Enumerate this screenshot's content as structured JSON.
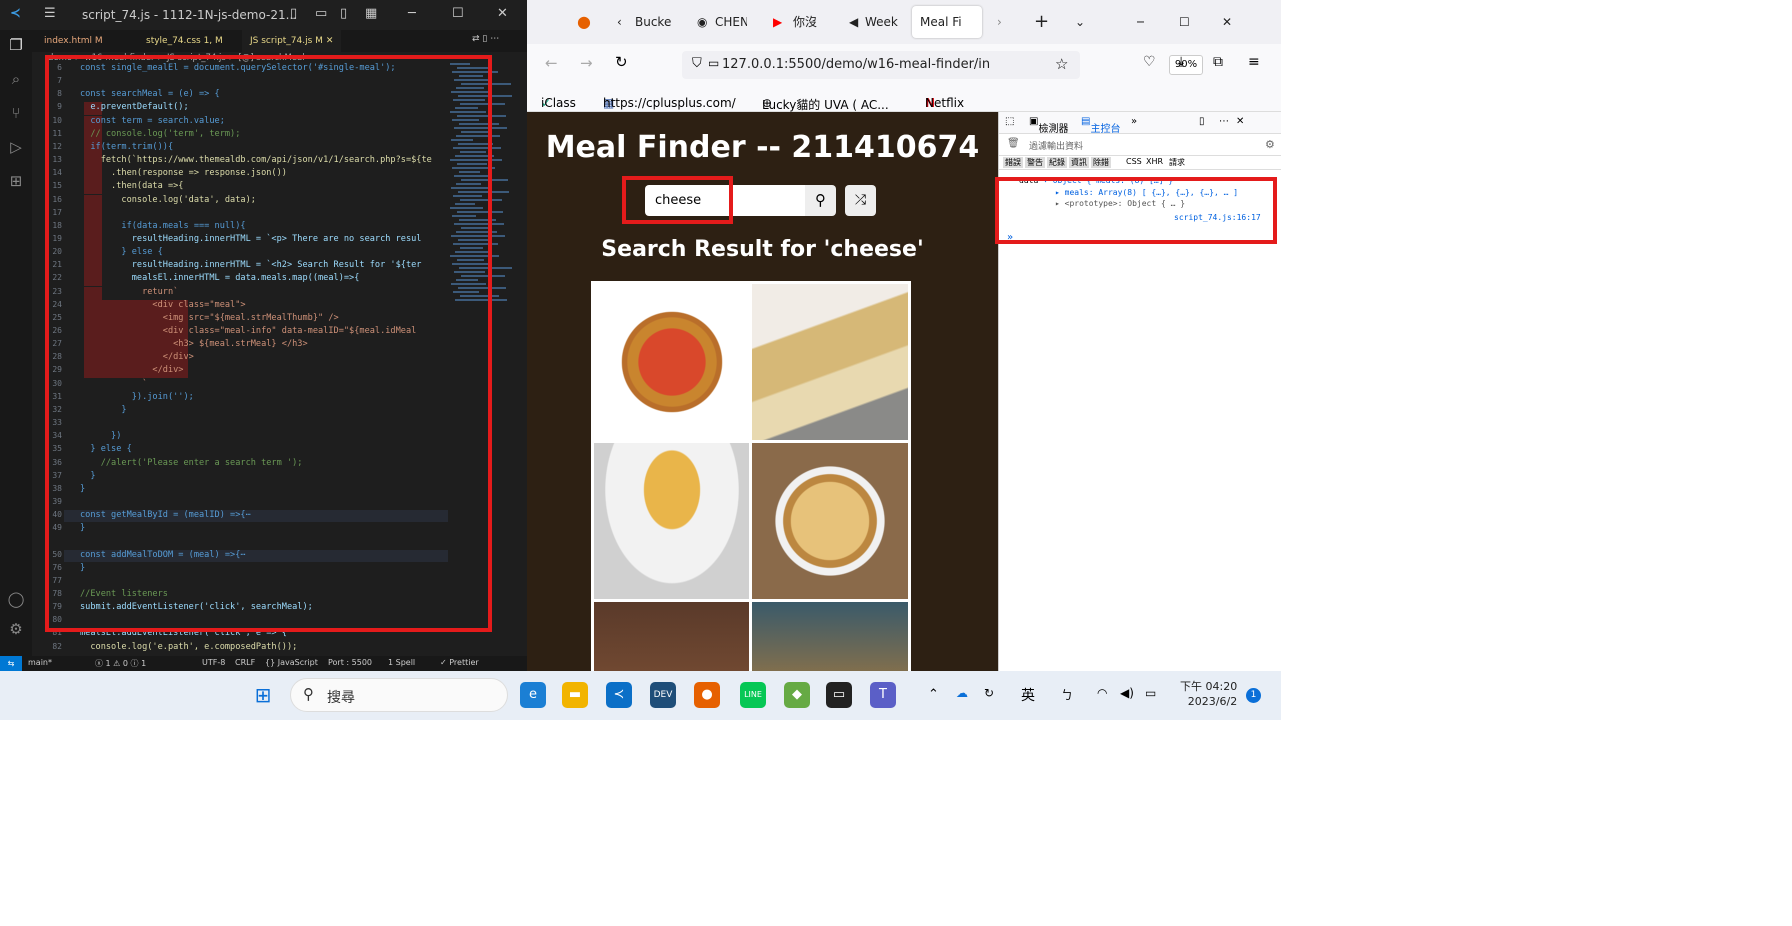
{
  "vscode": {
    "title": "script_74.js - 1112-1N-js-demo-21...",
    "tabs": [
      {
        "label": "index.html M",
        "active": false
      },
      {
        "label": "style_74.css 1, M",
        "active": false
      },
      {
        "label": "JS script_74.js M",
        "active": true
      }
    ],
    "breadcrumb": "demo > w16-meal-finder > JS script_74.js > [@] searchMeal",
    "code_lines": [
      {
        "n": "6",
        "t": "const single_mealEl = document.querySelector('#single-meal');"
      },
      {
        "n": "7",
        "t": ""
      },
      {
        "n": "8",
        "t": "const searchMeal = (e) => {"
      },
      {
        "n": "9",
        "t": "  e.preventDefault();"
      },
      {
        "n": "10",
        "t": "  const term = search.value;"
      },
      {
        "n": "11",
        "t": "  // console.log('term', term);"
      },
      {
        "n": "12",
        "t": "  if(term.trim()){"
      },
      {
        "n": "13",
        "t": "    fetch(`https://www.themealdb.com/api/json/v1/1/search.php?s=${te"
      },
      {
        "n": "14",
        "t": "      .then(response => response.json())"
      },
      {
        "n": "15",
        "t": "      .then(data =>{"
      },
      {
        "n": "16",
        "t": "        console.log('data', data);"
      },
      {
        "n": "17",
        "t": ""
      },
      {
        "n": "18",
        "t": "        if(data.meals === null){"
      },
      {
        "n": "19",
        "t": "          resultHeading.innerHTML = `<p> There are no search resul"
      },
      {
        "n": "20",
        "t": "        } else {"
      },
      {
        "n": "21",
        "t": "          resultHeading.innerHTML = `<h2> Search Result for '${ter"
      },
      {
        "n": "22",
        "t": "          mealsEl.innerHTML = data.meals.map((meal)=>{"
      },
      {
        "n": "23",
        "t": "            return`"
      },
      {
        "n": "24",
        "t": "              <div class=\"meal\">"
      },
      {
        "n": "25",
        "t": "                <img src=\"${meal.strMealThumb}\" />"
      },
      {
        "n": "26",
        "t": "                <div class=\"meal-info\" data-mealID=\"${meal.idMeal"
      },
      {
        "n": "27",
        "t": "                  <h3> ${meal.strMeal} </h3>"
      },
      {
        "n": "28",
        "t": "                </div>"
      },
      {
        "n": "29",
        "t": "              </div>"
      },
      {
        "n": "30",
        "t": "            `"
      },
      {
        "n": "31",
        "t": "          }).join('');"
      },
      {
        "n": "32",
        "t": "        }"
      },
      {
        "n": "33",
        "t": ""
      },
      {
        "n": "34",
        "t": "      })"
      },
      {
        "n": "35",
        "t": "  } else {"
      },
      {
        "n": "36",
        "t": "    //alert('Please enter a search term ');"
      },
      {
        "n": "37",
        "t": "  }"
      },
      {
        "n": "38",
        "t": "}"
      },
      {
        "n": "39",
        "t": ""
      },
      {
        "n": "40",
        "t": "const getMealById = (mealID) =>{⋯"
      },
      {
        "n": "49",
        "t": "}"
      },
      {
        "n": "",
        "t": ""
      },
      {
        "n": "50",
        "t": "const addMealToDOM = (meal) =>{⋯"
      },
      {
        "n": "76",
        "t": "}"
      },
      {
        "n": "77",
        "t": ""
      },
      {
        "n": "78",
        "t": "//Event listeners"
      },
      {
        "n": "79",
        "t": "submit.addEventListener('click', searchMeal);"
      },
      {
        "n": "80",
        "t": ""
      },
      {
        "n": "81",
        "t": "mealsEl.addEventListener('click', e => {"
      },
      {
        "n": "82",
        "t": "  console.log('e.path', e.composedPath());"
      }
    ],
    "status": {
      "branch": "main*",
      "problems": "ⓧ 1 ⚠ 0 ⓘ 1",
      "encoding": "UTF-8",
      "eol": "CRLF",
      "language": "{} JavaScript",
      "port": "Port : 5500",
      "spell": "1 Spell",
      "prettier": "✓ Prettier"
    }
  },
  "firefox": {
    "tabs": [
      {
        "label": "Bucke"
      },
      {
        "label": "CHEN"
      },
      {
        "label": "你沒"
      },
      {
        "label": "Week"
      },
      {
        "label": "Meal Fi"
      }
    ],
    "url": "127.0.0.1:5500/demo/w16-meal-finder/in",
    "zoom": "90%",
    "bookmarks": [
      "iClass",
      "https://cplusplus.com/",
      "Lucky貓的 UVA ( AC...",
      "Netflix"
    ]
  },
  "page": {
    "title": "Meal Finder -- 211410674",
    "search_value": "cheese",
    "result_heading": "Search Result for 'cheese'"
  },
  "devtools": {
    "tabs": [
      "檢測器",
      "主控台"
    ],
    "filter_placeholder": "過濾輸出資料",
    "levels": [
      "錯誤",
      "警告",
      "紀錄",
      "資訊",
      "除錯",
      "CSS",
      "XHR",
      "請求"
    ],
    "console": {
      "line1_key": "data",
      "line1_val": "▾ Object { meals: (8) […] }",
      "line2": "▸ meals: Array(8) [ {…}, {…}, {…}, … ]",
      "line3": "▸ <prototype>: Object { … }",
      "source": "script_74.js:16:17",
      "prompt": "»"
    }
  },
  "taskbar": {
    "search_label": "搜尋",
    "ime": "英",
    "time": "下午 04:20",
    "date": "2023/6/2",
    "badge": "1"
  },
  "colors": {
    "highlight": "#e41b1b",
    "page_bg": "#2d2013",
    "vscode_bg": "#1e1e1e"
  }
}
